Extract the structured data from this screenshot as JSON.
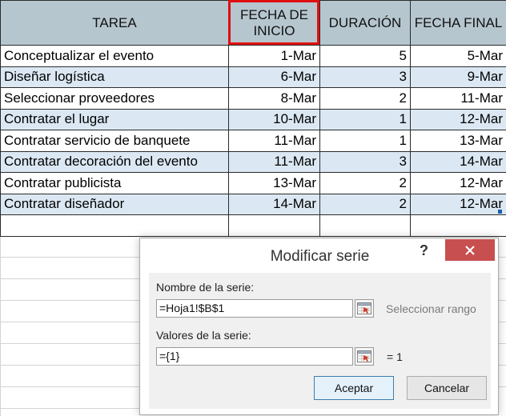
{
  "table": {
    "headers": {
      "task": "TAREA",
      "start_line1": "FECHA DE",
      "start_line2": "INICIO",
      "duration": "DURACIÓN",
      "end": "FECHA FINAL"
    },
    "rows": [
      {
        "task": "Conceptualizar el evento",
        "start": "1-Mar",
        "duration": "5",
        "end": "5-Mar"
      },
      {
        "task": "Diseñar logística",
        "start": "6-Mar",
        "duration": "3",
        "end": "9-Mar"
      },
      {
        "task": "Seleccionar proveedores",
        "start": "8-Mar",
        "duration": "2",
        "end": "11-Mar"
      },
      {
        "task": "Contratar el lugar",
        "start": "10-Mar",
        "duration": "1",
        "end": "12-Mar"
      },
      {
        "task": "Contratar servicio de banquete",
        "start": "11-Mar",
        "duration": "1",
        "end": "13-Mar"
      },
      {
        "task": "Contratar decoración del evento",
        "start": "11-Mar",
        "duration": "3",
        "end": "14-Mar"
      },
      {
        "task": "Contratar publicista",
        "start": "13-Mar",
        "duration": "2",
        "end": "12-Mar"
      },
      {
        "task": "Contratar diseñador",
        "start": "14-Mar",
        "duration": "2",
        "end": "12-Mar"
      }
    ]
  },
  "dialog": {
    "title": "Modificar serie",
    "help": "?",
    "series_name_label": "Nombre de la serie:",
    "series_name_value": "=Hoja1!$B$1",
    "series_name_hint": "Seleccionar rango",
    "series_values_label": "Valores de la serie:",
    "series_values_value": "={1}",
    "series_values_result": "= 1",
    "ok_label": "Aceptar",
    "cancel_label": "Cancelar"
  },
  "colors": {
    "header_bg": "#b6c6cf",
    "alt_row_bg": "#dbe8f3",
    "highlight_border": "#e01010",
    "close_button": "#c74f4f"
  },
  "icons": {
    "close": "close-icon",
    "range_select": "range-select-icon"
  }
}
